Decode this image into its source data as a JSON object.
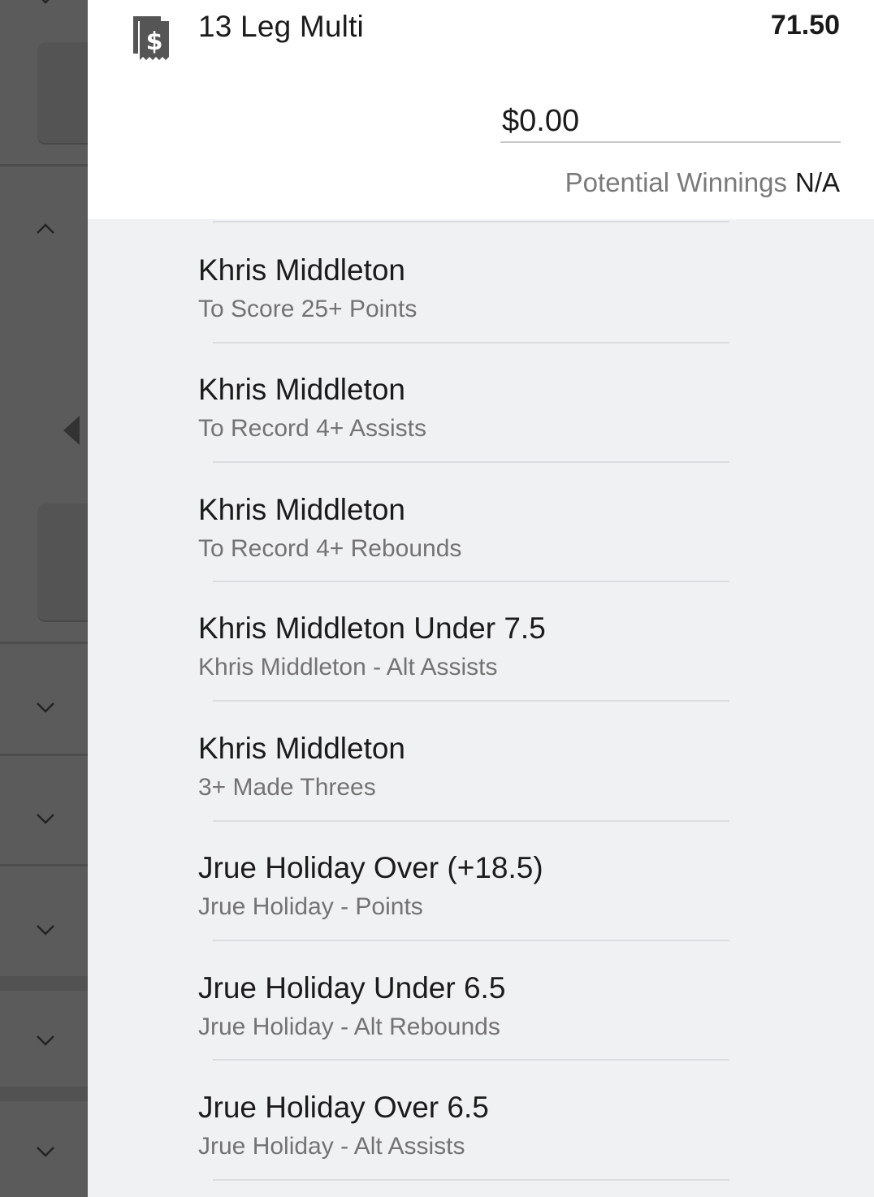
{
  "bet_slip": {
    "title": "13 Leg Multi",
    "odds": "71.50",
    "stake_value": "$0.00",
    "potential_winnings_label": "Potential Winnings",
    "potential_winnings_value": "N/A",
    "icon": "receipt-dollar-icon"
  },
  "legs": [
    {
      "selection": "Khris Middleton",
      "market": "To Score 25+ Points"
    },
    {
      "selection": "Khris Middleton",
      "market": "To Record 4+ Assists"
    },
    {
      "selection": "Khris Middleton",
      "market": "To Record 4+ Rebounds"
    },
    {
      "selection": "Khris Middleton Under 7.5",
      "market": "Khris Middleton - Alt Assists"
    },
    {
      "selection": "Khris Middleton",
      "market": "3+ Made Threes"
    },
    {
      "selection": "Jrue Holiday Over (+18.5)",
      "market": "Jrue Holiday - Points"
    },
    {
      "selection": "Jrue Holiday Under 6.5",
      "market": "Jrue Holiday - Alt Rebounds"
    },
    {
      "selection": "Jrue Holiday Over 6.5",
      "market": "Jrue Holiday - Alt Assists"
    }
  ],
  "sidebar": {
    "chevrons": [
      "chevron-up-icon",
      "chevron-down-icon",
      "chevron-down-icon",
      "chevron-down-icon",
      "chevron-down-icon",
      "chevron-down-icon"
    ],
    "collapse_arrow": "caret-left-icon"
  },
  "colors": {
    "sidebar_bg": "#5b5b5b",
    "list_bg": "#f0f1f3",
    "header_bg": "#ffffff",
    "text_primary": "#1b1b1b",
    "text_secondary": "#737373"
  }
}
